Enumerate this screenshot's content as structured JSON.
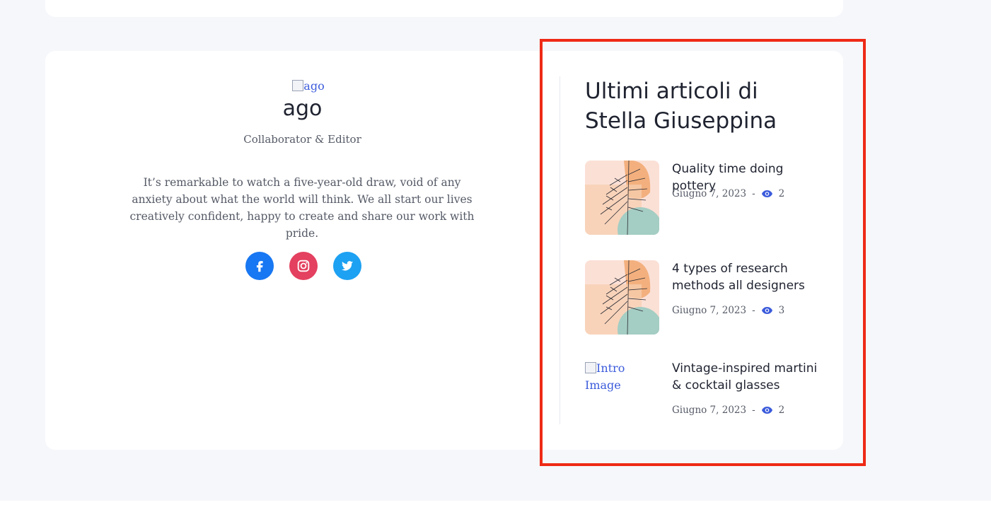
{
  "author": {
    "avatar_alt": "ago",
    "name": "ago",
    "role": "Collaborator & Editor",
    "bio": "It’s remarkable to watch a five-year-old draw, void of any anxiety about what the world will think. We all start our lives creatively confident, happy to create and share our work with pride.",
    "socials": [
      {
        "icon": "facebook-icon",
        "color": "#1877f2"
      },
      {
        "icon": "instagram-icon",
        "color": "#e4405f"
      },
      {
        "icon": "twitter-icon",
        "color": "#1da1f2"
      }
    ]
  },
  "latest": {
    "title": "Ultimi articoli di Stella Giuseppina",
    "posts": [
      {
        "title": "Quality time doing pottery",
        "date": "Giugno 7, 2023",
        "separator": "-",
        "views": "2",
        "image": "botanical-illustration"
      },
      {
        "title": "4 types of research methods all designers",
        "date": "Giugno 7, 2023",
        "separator": "-",
        "views": "3",
        "image": "botanical-illustration"
      },
      {
        "title": "Vintage-inspired martini & cocktail glasses",
        "date": "Giugno 7, 2023",
        "separator": "-",
        "views": "2",
        "image_alt": "Intro Image"
      }
    ]
  },
  "colors": {
    "accent": "#3b5bdb",
    "highlight": "#ee2a16",
    "page_bg": "#f6f7fb"
  }
}
